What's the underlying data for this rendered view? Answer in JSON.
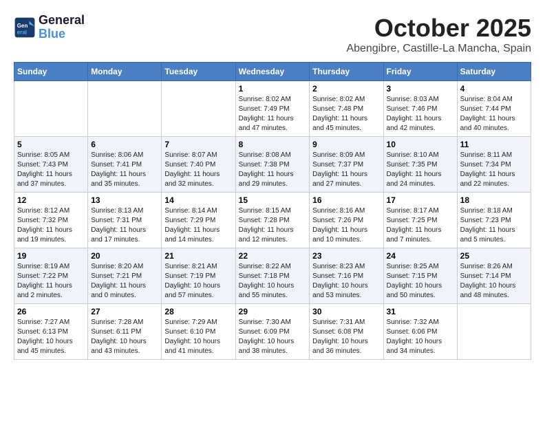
{
  "logo": {
    "line1": "General",
    "line2": "Blue"
  },
  "title": "October 2025",
  "subtitle": "Abengibre, Castille-La Mancha, Spain",
  "weekdays": [
    "Sunday",
    "Monday",
    "Tuesday",
    "Wednesday",
    "Thursday",
    "Friday",
    "Saturday"
  ],
  "weeks": [
    [
      {
        "day": "",
        "info": ""
      },
      {
        "day": "",
        "info": ""
      },
      {
        "day": "",
        "info": ""
      },
      {
        "day": "1",
        "info": "Sunrise: 8:02 AM\nSunset: 7:49 PM\nDaylight: 11 hours and 47 minutes."
      },
      {
        "day": "2",
        "info": "Sunrise: 8:02 AM\nSunset: 7:48 PM\nDaylight: 11 hours and 45 minutes."
      },
      {
        "day": "3",
        "info": "Sunrise: 8:03 AM\nSunset: 7:46 PM\nDaylight: 11 hours and 42 minutes."
      },
      {
        "day": "4",
        "info": "Sunrise: 8:04 AM\nSunset: 7:44 PM\nDaylight: 11 hours and 40 minutes."
      }
    ],
    [
      {
        "day": "5",
        "info": "Sunrise: 8:05 AM\nSunset: 7:43 PM\nDaylight: 11 hours and 37 minutes."
      },
      {
        "day": "6",
        "info": "Sunrise: 8:06 AM\nSunset: 7:41 PM\nDaylight: 11 hours and 35 minutes."
      },
      {
        "day": "7",
        "info": "Sunrise: 8:07 AM\nSunset: 7:40 PM\nDaylight: 11 hours and 32 minutes."
      },
      {
        "day": "8",
        "info": "Sunrise: 8:08 AM\nSunset: 7:38 PM\nDaylight: 11 hours and 29 minutes."
      },
      {
        "day": "9",
        "info": "Sunrise: 8:09 AM\nSunset: 7:37 PM\nDaylight: 11 hours and 27 minutes."
      },
      {
        "day": "10",
        "info": "Sunrise: 8:10 AM\nSunset: 7:35 PM\nDaylight: 11 hours and 24 minutes."
      },
      {
        "day": "11",
        "info": "Sunrise: 8:11 AM\nSunset: 7:34 PM\nDaylight: 11 hours and 22 minutes."
      }
    ],
    [
      {
        "day": "12",
        "info": "Sunrise: 8:12 AM\nSunset: 7:32 PM\nDaylight: 11 hours and 19 minutes."
      },
      {
        "day": "13",
        "info": "Sunrise: 8:13 AM\nSunset: 7:31 PM\nDaylight: 11 hours and 17 minutes."
      },
      {
        "day": "14",
        "info": "Sunrise: 8:14 AM\nSunset: 7:29 PM\nDaylight: 11 hours and 14 minutes."
      },
      {
        "day": "15",
        "info": "Sunrise: 8:15 AM\nSunset: 7:28 PM\nDaylight: 11 hours and 12 minutes."
      },
      {
        "day": "16",
        "info": "Sunrise: 8:16 AM\nSunset: 7:26 PM\nDaylight: 11 hours and 10 minutes."
      },
      {
        "day": "17",
        "info": "Sunrise: 8:17 AM\nSunset: 7:25 PM\nDaylight: 11 hours and 7 minutes."
      },
      {
        "day": "18",
        "info": "Sunrise: 8:18 AM\nSunset: 7:23 PM\nDaylight: 11 hours and 5 minutes."
      }
    ],
    [
      {
        "day": "19",
        "info": "Sunrise: 8:19 AM\nSunset: 7:22 PM\nDaylight: 11 hours and 2 minutes."
      },
      {
        "day": "20",
        "info": "Sunrise: 8:20 AM\nSunset: 7:21 PM\nDaylight: 11 hours and 0 minutes."
      },
      {
        "day": "21",
        "info": "Sunrise: 8:21 AM\nSunset: 7:19 PM\nDaylight: 10 hours and 57 minutes."
      },
      {
        "day": "22",
        "info": "Sunrise: 8:22 AM\nSunset: 7:18 PM\nDaylight: 10 hours and 55 minutes."
      },
      {
        "day": "23",
        "info": "Sunrise: 8:23 AM\nSunset: 7:16 PM\nDaylight: 10 hours and 53 minutes."
      },
      {
        "day": "24",
        "info": "Sunrise: 8:25 AM\nSunset: 7:15 PM\nDaylight: 10 hours and 50 minutes."
      },
      {
        "day": "25",
        "info": "Sunrise: 8:26 AM\nSunset: 7:14 PM\nDaylight: 10 hours and 48 minutes."
      }
    ],
    [
      {
        "day": "26",
        "info": "Sunrise: 7:27 AM\nSunset: 6:13 PM\nDaylight: 10 hours and 45 minutes."
      },
      {
        "day": "27",
        "info": "Sunrise: 7:28 AM\nSunset: 6:11 PM\nDaylight: 10 hours and 43 minutes."
      },
      {
        "day": "28",
        "info": "Sunrise: 7:29 AM\nSunset: 6:10 PM\nDaylight: 10 hours and 41 minutes."
      },
      {
        "day": "29",
        "info": "Sunrise: 7:30 AM\nSunset: 6:09 PM\nDaylight: 10 hours and 38 minutes."
      },
      {
        "day": "30",
        "info": "Sunrise: 7:31 AM\nSunset: 6:08 PM\nDaylight: 10 hours and 36 minutes."
      },
      {
        "day": "31",
        "info": "Sunrise: 7:32 AM\nSunset: 6:06 PM\nDaylight: 10 hours and 34 minutes."
      },
      {
        "day": "",
        "info": ""
      }
    ]
  ]
}
